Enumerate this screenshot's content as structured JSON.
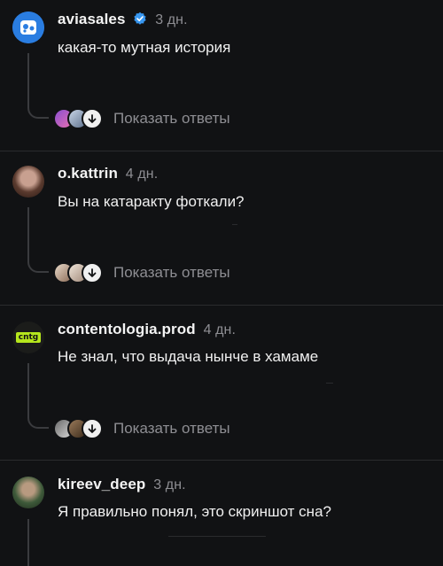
{
  "comments": [
    {
      "username": "aviasales",
      "verified": true,
      "time": "3 дн.",
      "text": "какая-то мутная история",
      "show_replies": "Показать ответы"
    },
    {
      "username": "o.kattrin",
      "verified": false,
      "time": "4 дн.",
      "text": "Вы на катаракту фоткали?",
      "show_replies": "Показать ответы"
    },
    {
      "username": "contentologia.prod",
      "verified": false,
      "time": "4 дн.",
      "text": "Не знал, что выдача нынче в хамаме",
      "show_replies": "Показать ответы",
      "avatar_text": "cntg"
    },
    {
      "username": "kireev_deep",
      "verified": false,
      "time": "3 дн.",
      "text": "Я правильно понял, это скриншот сна?"
    }
  ],
  "colors": {
    "background": "#111214",
    "muted": "#8e8e93",
    "verified": "#3897f0",
    "aviasales_brand": "#2a7de1",
    "cntg_green": "#b5e61d"
  }
}
